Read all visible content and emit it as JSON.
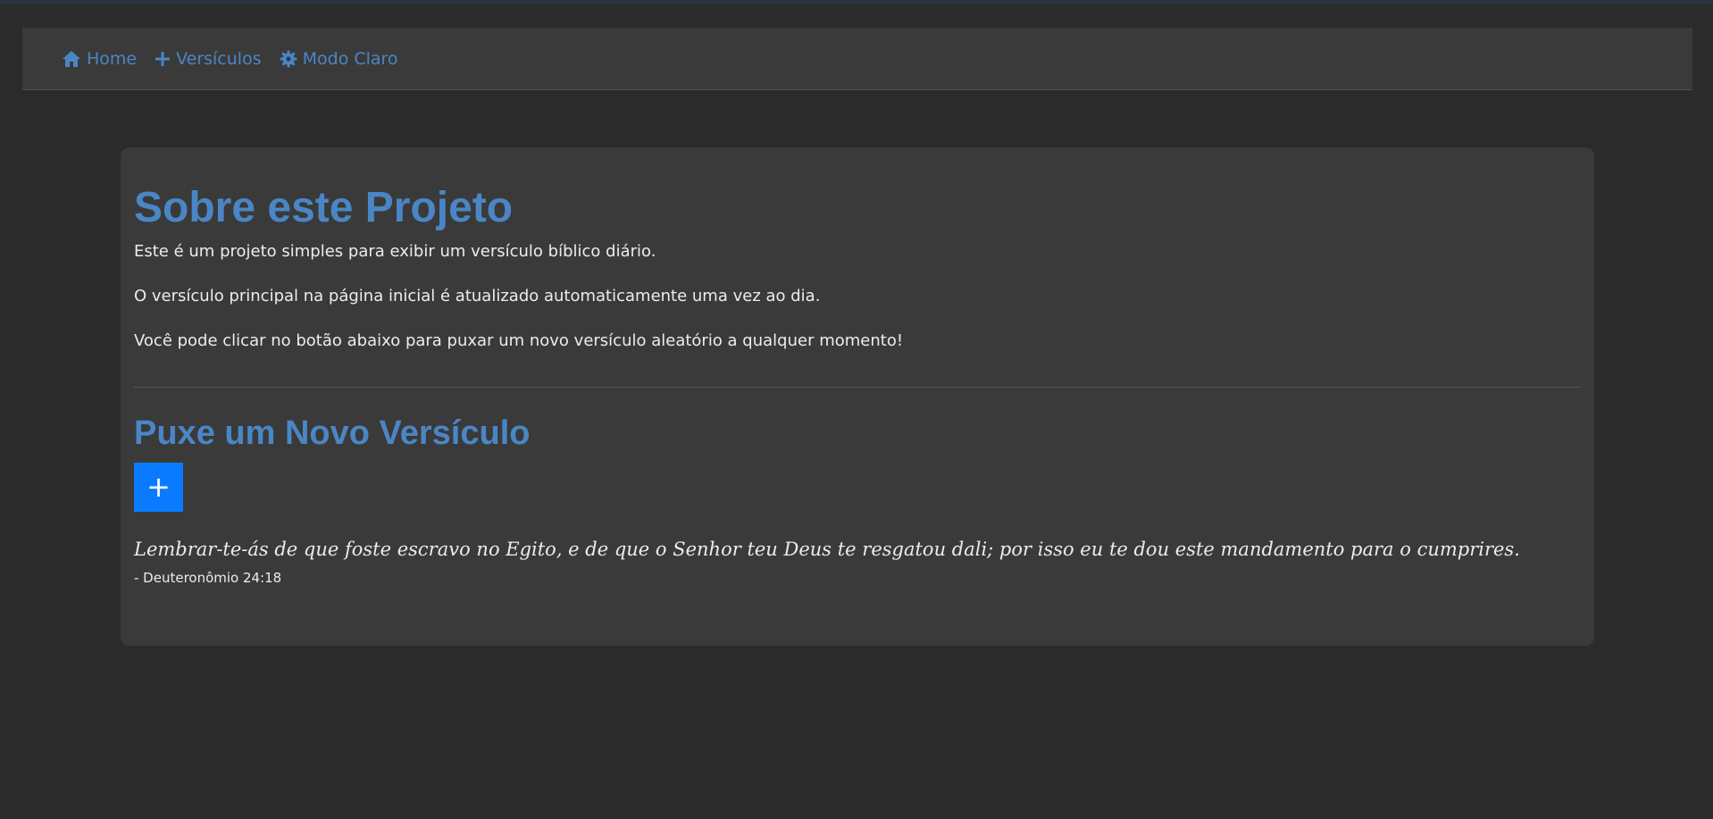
{
  "colors": {
    "background": "#2b2b2b",
    "panel": "#3a3a3a",
    "accent": "#4a86c5",
    "button": "#0a7bff",
    "text": "#ececec"
  },
  "nav": {
    "items": [
      {
        "icon": "home-icon",
        "label": "Home"
      },
      {
        "icon": "plus-icon",
        "label": "Versículos"
      },
      {
        "icon": "gear-icon",
        "label": "Modo Claro"
      }
    ]
  },
  "about": {
    "title": "Sobre este Projeto",
    "paragraphs": [
      "Este é um projeto simples para exibir um versículo bíblico diário.",
      "O versículo principal na página inicial é atualizado automaticamente uma vez ao dia.",
      "Você pode clicar no botão abaixo para puxar um novo versículo aleatório a qualquer momento!"
    ]
  },
  "new_verse": {
    "title": "Puxe um Novo Versículo",
    "button_label": "+",
    "verse_text": "Lembrar-te-ás de que foste escravo no Egito, e de que o Senhor teu Deus te resgatou dali; por isso eu te dou este mandamento para o cumprires.",
    "verse_reference": "- Deuteronômio 24:18"
  }
}
